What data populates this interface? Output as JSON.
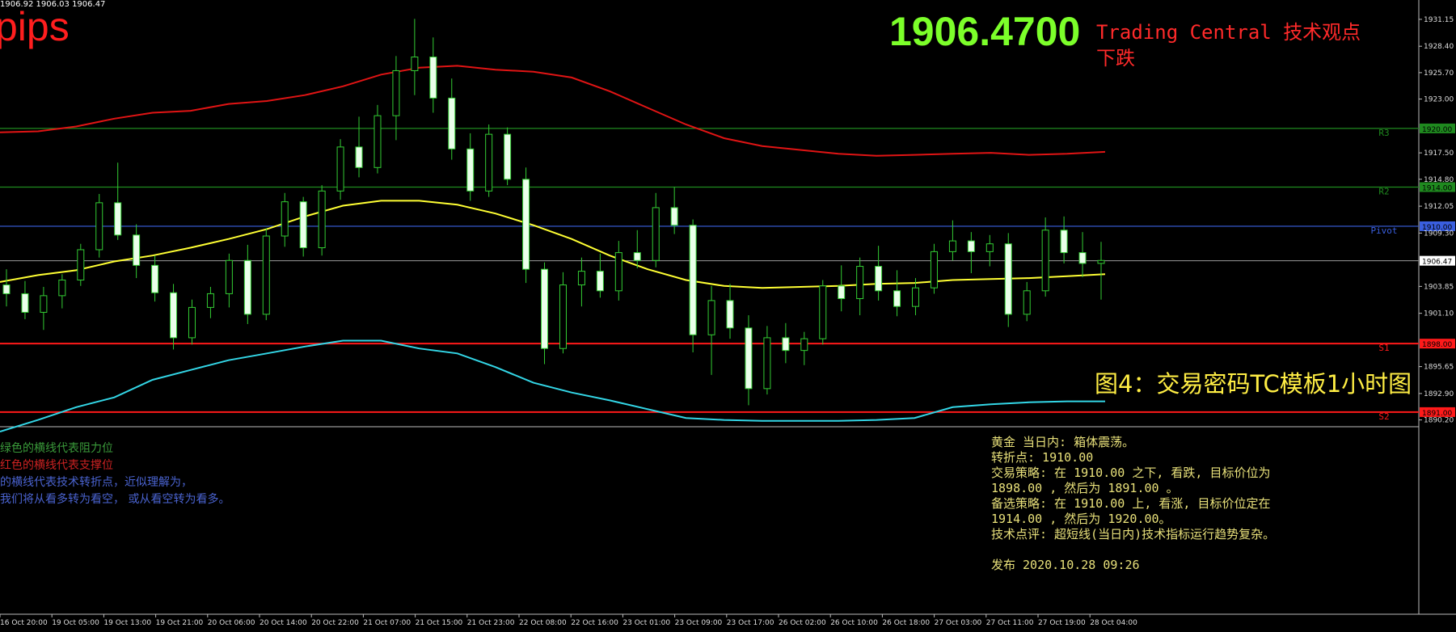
{
  "ohlc_text": "1906.92 1906.03 1906.47",
  "pips_label": "pips",
  "big_price": "1906.4700",
  "tc_title": "Trading Central 技术观点",
  "tc_view": "下跌",
  "caption": "图4：交易密码TC模板1小时图",
  "legend": [
    {
      "text": "绿色的横线代表阻力位",
      "color": "#3a9a3a"
    },
    {
      "text": "红色的横线代表支撑位",
      "color": "#cc2222"
    },
    {
      "text": "的横线代表技术转折点，近似理解为，",
      "color": "#4a63d0"
    },
    {
      "text": "我们将从看多转为看空， 或从看空转为看多。",
      "color": "#4a63d0"
    }
  ],
  "comment": [
    "黄金 当日内: 箱体震荡。",
    "转折点: 1910.00",
    "交易策略: 在 1910.00 之下, 看跌, 目标价位为",
    "1898.00 , 然后为 1891.00 。",
    "备选策略: 在 1910.00  上, 看涨, 目标价位定在",
    "1914.00 , 然后为 1920.00。",
    "技术点评: 超短线(当日内)技术指标运行趋势复杂。",
    "",
    "发布 2020.10.28 09:26"
  ],
  "chart_data": {
    "type": "candlestick",
    "price_axis_ticks": [
      "1931.15",
      "1928.40",
      "1925.70",
      "1923.00",
      "1917.50",
      "1914.80",
      "1912.05",
      "1909.30",
      "1903.85",
      "1901.10",
      "1895.65",
      "1892.90",
      "1890.20"
    ],
    "current_price": "1906.47",
    "ylim": [
      1890.0,
      1932.3
    ],
    "time_labels": [
      "16 Oct 20:00",
      "19 Oct 05:00",
      "19 Oct 13:00",
      "19 Oct 21:00",
      "20 Oct 06:00",
      "20 Oct 14:00",
      "20 Oct 22:00",
      "21 Oct 07:00",
      "21 Oct 15:00",
      "21 Oct 23:00",
      "22 Oct 08:00",
      "22 Oct 16:00",
      "23 Oct 01:00",
      "23 Oct 09:00",
      "23 Oct 17:00",
      "26 Oct 02:00",
      "26 Oct 10:00",
      "26 Oct 18:00",
      "27 Oct 03:00",
      "27 Oct 11:00",
      "27 Oct 19:00",
      "28 Oct 04:00"
    ],
    "levels": [
      {
        "name": "R3",
        "value": 1920.0,
        "label": "1920.00",
        "color": "#1f8a1f"
      },
      {
        "name": "R2",
        "value": 1914.0,
        "label": "1914.00",
        "color": "#1f8a1f"
      },
      {
        "name": "Pivot",
        "value": 1910.0,
        "label": "1910.00",
        "color": "#3a5fe0"
      },
      {
        "name": "S1",
        "value": 1898.0,
        "label": "1898.00",
        "color": "#ff1a1a"
      },
      {
        "name": "S2",
        "value": 1891.0,
        "label": "1891.00",
        "color": "#ff1a1a"
      }
    ],
    "series": [
      {
        "kind": "upper-band",
        "color": "#e01414",
        "values": [
          1919.6,
          1919.7,
          1920.2,
          1921.0,
          1921.6,
          1921.8,
          1922.5,
          1922.8,
          1923.4,
          1924.3,
          1925.5,
          1926.2,
          1926.4,
          1926.0,
          1925.8,
          1925.2,
          1923.8,
          1922.1,
          1920.4,
          1919.0,
          1918.2,
          1917.8,
          1917.4,
          1917.2,
          1917.3,
          1917.4,
          1917.5,
          1917.3,
          1917.4,
          1917.6
        ]
      },
      {
        "kind": "moving-average",
        "color": "#ffff33",
        "values": [
          1904.3,
          1905.0,
          1905.5,
          1906.4,
          1907.0,
          1907.8,
          1908.7,
          1909.7,
          1911.0,
          1912.1,
          1912.6,
          1912.6,
          1912.2,
          1911.3,
          1910.1,
          1908.7,
          1907.0,
          1905.6,
          1904.5,
          1903.9,
          1903.7,
          1903.8,
          1903.9,
          1904.1,
          1904.2,
          1904.5,
          1904.6,
          1904.7,
          1904.9,
          1905.1
        ]
      },
      {
        "kind": "lower-band",
        "color": "#33d6e6",
        "values": [
          1889.0,
          1890.2,
          1891.5,
          1892.5,
          1894.3,
          1895.3,
          1896.3,
          1897.0,
          1897.7,
          1898.3,
          1898.3,
          1897.5,
          1897.0,
          1895.6,
          1894.0,
          1893.0,
          1892.2,
          1891.3,
          1890.4,
          1890.2,
          1890.1,
          1890.1,
          1890.1,
          1890.2,
          1890.4,
          1891.5,
          1891.8,
          1892.0,
          1892.1,
          1892.1
        ]
      }
    ],
    "candles": [
      [
        1904.0,
        1905.6,
        1901.8,
        1903.1
      ],
      [
        1903.1,
        1904.4,
        1900.5,
        1901.2
      ],
      [
        1901.2,
        1903.8,
        1899.4,
        1902.9
      ],
      [
        1902.9,
        1905.1,
        1901.6,
        1904.5
      ],
      [
        1904.5,
        1908.2,
        1903.9,
        1907.6
      ],
      [
        1907.6,
        1913.3,
        1906.8,
        1912.4
      ],
      [
        1912.4,
        1916.5,
        1908.6,
        1909.1
      ],
      [
        1909.1,
        1910.2,
        1904.7,
        1906.0
      ],
      [
        1906.0,
        1907.0,
        1902.3,
        1903.2
      ],
      [
        1903.2,
        1904.1,
        1897.4,
        1898.6
      ],
      [
        1898.6,
        1902.5,
        1897.9,
        1901.7
      ],
      [
        1901.7,
        1903.8,
        1900.6,
        1903.1
      ],
      [
        1903.1,
        1907.2,
        1901.7,
        1906.5
      ],
      [
        1906.5,
        1908.1,
        1900.0,
        1901.0
      ],
      [
        1901.0,
        1909.8,
        1900.4,
        1909.0
      ],
      [
        1909.0,
        1913.4,
        1907.9,
        1912.5
      ],
      [
        1912.5,
        1913.0,
        1906.9,
        1907.8
      ],
      [
        1907.8,
        1914.2,
        1907.0,
        1913.6
      ],
      [
        1913.6,
        1918.9,
        1912.7,
        1918.1
      ],
      [
        1918.1,
        1921.2,
        1915.0,
        1916.0
      ],
      [
        1916.0,
        1922.4,
        1915.4,
        1921.3
      ],
      [
        1921.3,
        1927.4,
        1918.8,
        1925.9
      ],
      [
        1925.9,
        1931.2,
        1923.4,
        1927.3
      ],
      [
        1927.3,
        1929.3,
        1921.6,
        1923.1
      ],
      [
        1923.1,
        1925.1,
        1916.8,
        1917.9
      ],
      [
        1917.9,
        1919.5,
        1912.6,
        1913.6
      ],
      [
        1913.6,
        1920.4,
        1913.0,
        1919.4
      ],
      [
        1919.4,
        1920.1,
        1914.2,
        1914.8
      ],
      [
        1914.8,
        1916.0,
        1904.2,
        1905.6
      ],
      [
        1905.6,
        1906.3,
        1895.9,
        1897.5
      ],
      [
        1897.5,
        1905.3,
        1897.0,
        1904.0
      ],
      [
        1904.0,
        1906.8,
        1901.8,
        1905.4
      ],
      [
        1905.4,
        1907.2,
        1902.7,
        1903.4
      ],
      [
        1903.4,
        1908.5,
        1902.4,
        1907.3
      ],
      [
        1907.3,
        1909.6,
        1905.7,
        1906.5
      ],
      [
        1906.5,
        1913.4,
        1905.8,
        1911.9
      ],
      [
        1911.9,
        1914.0,
        1909.2,
        1910.1
      ],
      [
        1910.1,
        1910.7,
        1897.1,
        1898.9
      ],
      [
        1898.9,
        1903.9,
        1894.8,
        1902.4
      ],
      [
        1902.4,
        1904.1,
        1898.5,
        1899.6
      ],
      [
        1899.6,
        1900.9,
        1891.7,
        1893.4
      ],
      [
        1893.4,
        1899.8,
        1892.8,
        1898.6
      ],
      [
        1898.6,
        1900.1,
        1896.0,
        1897.3
      ],
      [
        1897.3,
        1899.2,
        1895.8,
        1898.5
      ],
      [
        1898.5,
        1904.5,
        1897.9,
        1903.9
      ],
      [
        1903.9,
        1906.0,
        1901.3,
        1902.6
      ],
      [
        1902.6,
        1906.8,
        1900.9,
        1905.9
      ],
      [
        1905.9,
        1908.0,
        1902.4,
        1903.4
      ],
      [
        1903.4,
        1905.5,
        1900.8,
        1901.8
      ],
      [
        1901.8,
        1904.7,
        1900.9,
        1903.7
      ],
      [
        1903.7,
        1908.2,
        1903.1,
        1907.4
      ],
      [
        1907.4,
        1910.6,
        1906.5,
        1908.5
      ],
      [
        1908.5,
        1909.4,
        1905.2,
        1907.4
      ],
      [
        1907.4,
        1909.1,
        1905.9,
        1908.2
      ],
      [
        1908.2,
        1909.3,
        1899.7,
        1901.0
      ],
      [
        1901.0,
        1904.3,
        1900.3,
        1903.4
      ],
      [
        1903.4,
        1910.9,
        1902.8,
        1909.6
      ],
      [
        1909.6,
        1911.0,
        1906.2,
        1907.3
      ],
      [
        1907.3,
        1909.4,
        1904.8,
        1906.2
      ],
      [
        1906.2,
        1908.4,
        1902.5,
        1906.5
      ]
    ]
  }
}
